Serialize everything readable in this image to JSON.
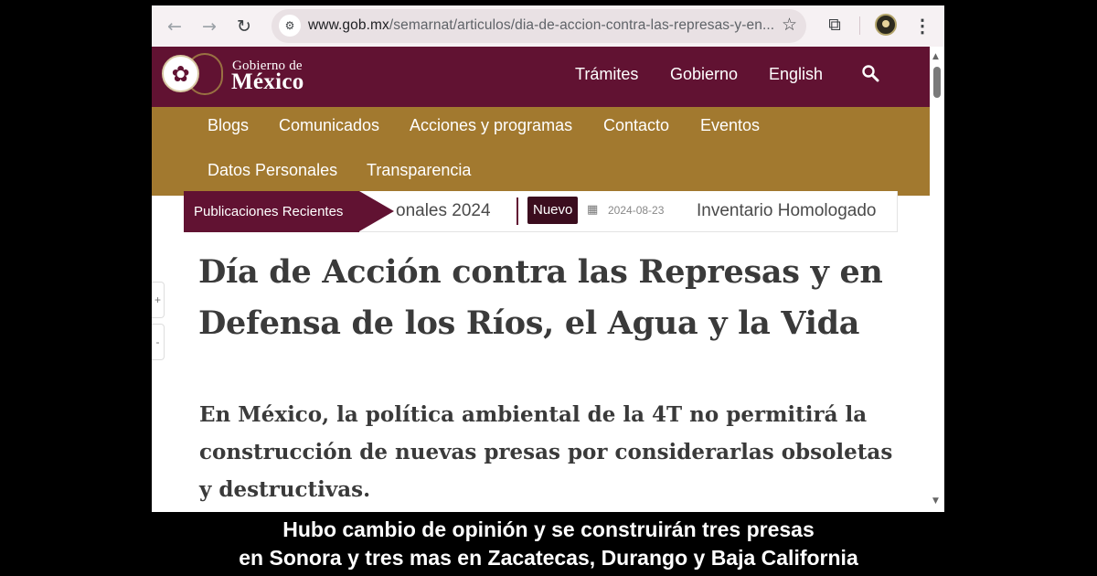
{
  "browser": {
    "url_host": "www.gob.mx",
    "url_path": "/semarnat/articulos/dia-de-accion-contra-las-represas-y-en...",
    "icons": {
      "back": "arrow-left-icon",
      "forward": "arrow-right-icon",
      "reload": "reload-icon",
      "site_info": "tune-icon",
      "bookmark": "star-icon",
      "extensions": "puzzle-icon",
      "menu": "kebab-menu-icon"
    }
  },
  "header": {
    "logo_top": "Gobierno de",
    "logo_bottom": "México",
    "nav": [
      "Trámites",
      "Gobierno",
      "English"
    ],
    "search_icon": "search-icon"
  },
  "menu": {
    "items": [
      "Blogs",
      "Comunicados",
      "Acciones y programas",
      "Contacto",
      "Eventos",
      "Datos Personales",
      "Transparencia"
    ]
  },
  "ticker": {
    "label": "Publicaciones Recientes",
    "prev_fragment": "onales 2024",
    "badge": "Nuevo",
    "date": "2024-08-23",
    "next_title": "Inventario Homologado"
  },
  "zoom": {
    "in": "+",
    "out": "-"
  },
  "article": {
    "title": "Día de Acción contra las Represas y en Defensa de los Ríos, el Agua y la Vida",
    "lead": "En México, la política ambiental de la 4T no permitirá la construcción de nuevas presas por considerarlas obsoletas y destructivas."
  },
  "caption": {
    "line1": "Hubo cambio de opinión y se construirán tres presas",
    "line2": "en Sonora y tres mas en Zacatecas, Durango y Baja California"
  },
  "colors": {
    "header": "#611232",
    "menu": "#a2792f",
    "toolbar": "#f6f1f3"
  }
}
